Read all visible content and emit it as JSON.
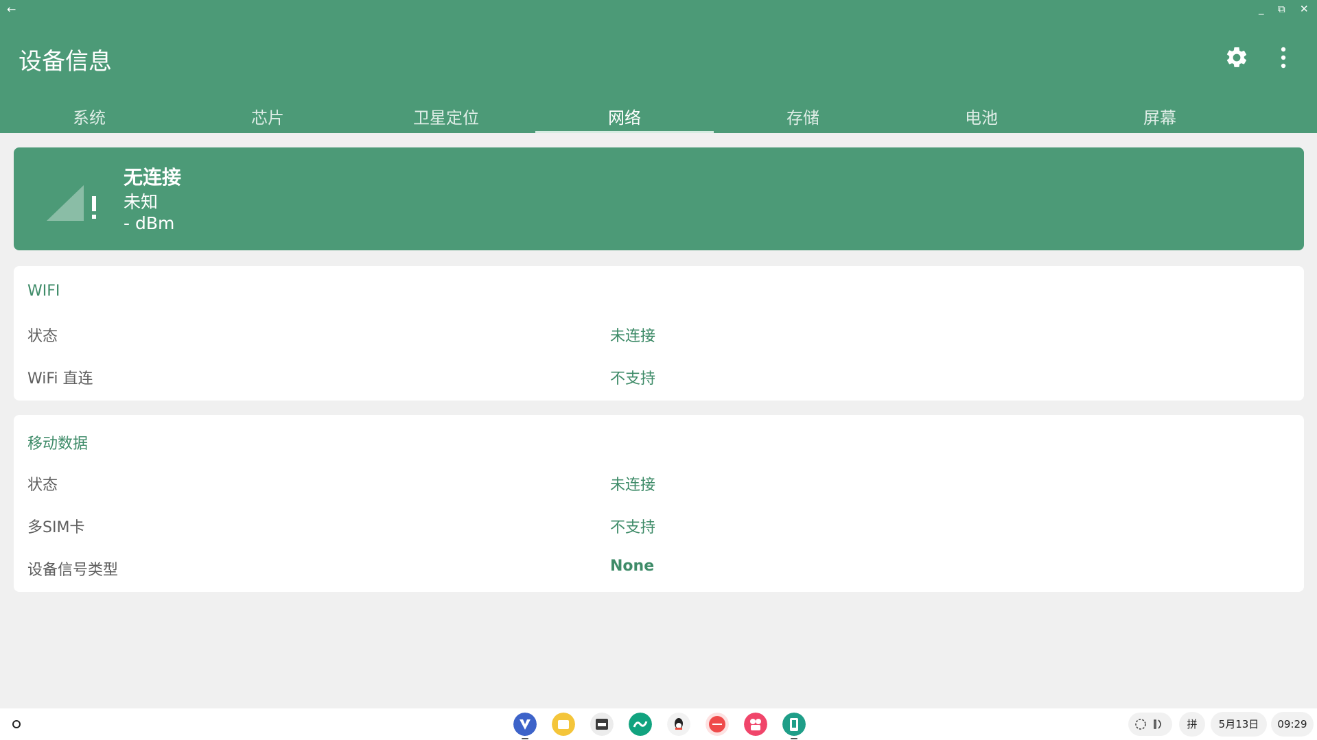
{
  "window": {
    "back_glyph": "←",
    "minimize_glyph": "_",
    "restore_glyph": "⧉",
    "close_glyph": "✕"
  },
  "app": {
    "title": "设备信息",
    "settings_icon": "gear-icon",
    "more_icon": "more-vert-icon",
    "accent_color": "#4c9a77"
  },
  "tabs": [
    {
      "label": "系统"
    },
    {
      "label": "芯片"
    },
    {
      "label": "卫星定位"
    },
    {
      "label": "网络",
      "active": true
    },
    {
      "label": "存储"
    },
    {
      "label": "电池"
    },
    {
      "label": "屏幕"
    }
  ],
  "signal": {
    "icon": "signal-warning-icon",
    "title": "无连接",
    "type": "未知",
    "dbm": "- dBm"
  },
  "wifi": {
    "title": "WIFI",
    "rows": [
      {
        "label": "状态",
        "value": "未连接"
      },
      {
        "label": "WiFi 直连",
        "value": "不支持"
      }
    ]
  },
  "mobile": {
    "title": "移动数据",
    "rows": [
      {
        "label": "状态",
        "value": "未连接"
      },
      {
        "label": "多SIM卡",
        "value": "不支持"
      },
      {
        "label": "设备信号类型",
        "value": "None"
      }
    ]
  },
  "taskbar": {
    "apps": [
      {
        "name": "app-v-icon",
        "color": "#3d63c9"
      },
      {
        "name": "files-icon",
        "color": "#f4c53a"
      },
      {
        "name": "mt-manager-icon",
        "color": "#3b3b3b"
      },
      {
        "name": "green-app-icon",
        "color": "#11a37f"
      },
      {
        "name": "qq-icon",
        "color": "#ffffff"
      },
      {
        "name": "red-app-icon",
        "color": "#ef4a4a"
      },
      {
        "name": "pink-app-icon",
        "color": "#f0456a"
      },
      {
        "name": "device-info-icon",
        "color": "#1f9e88"
      }
    ],
    "ime": "拼",
    "date": "5月13日",
    "time": "09:29"
  }
}
